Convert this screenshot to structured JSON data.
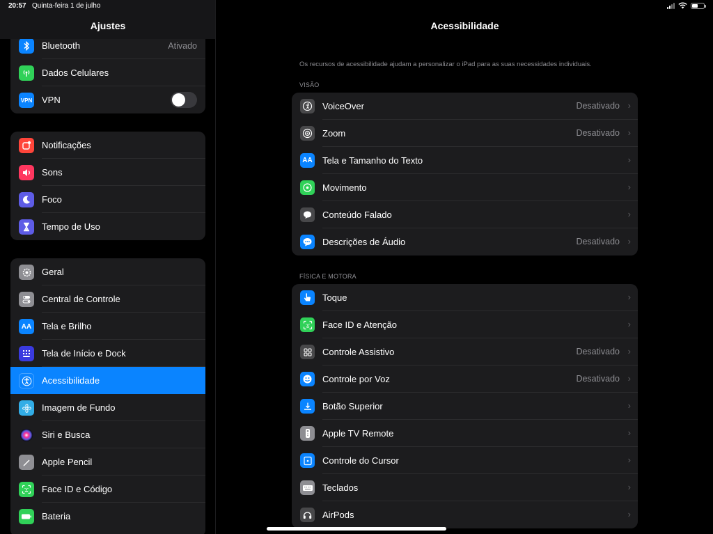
{
  "status": {
    "time": "20:57",
    "date": "Quinta-feira 1 de julho"
  },
  "sidebar": {
    "title": "Ajustes",
    "group1": [
      {
        "label": "Bluetooth",
        "value": "Ativado",
        "icon": "bluetooth-icon",
        "color": "#0a84ff"
      },
      {
        "label": "Dados Celulares",
        "icon": "antenna-icon",
        "color": "#30d158"
      },
      {
        "label": "VPN",
        "icon": "vpn-icon",
        "color": "#0a84ff"
      }
    ],
    "group2": [
      {
        "label": "Notificações",
        "icon": "notification-icon",
        "color": "#ff453a"
      },
      {
        "label": "Sons",
        "icon": "speaker-icon",
        "color": "#ff375f"
      },
      {
        "label": "Foco",
        "icon": "moon-icon",
        "color": "#5e5ce6"
      },
      {
        "label": "Tempo de Uso",
        "icon": "hourglass-icon",
        "color": "#5e5ce6"
      }
    ],
    "group3": [
      {
        "label": "Geral",
        "icon": "gear-icon",
        "color": "#8e8e93"
      },
      {
        "label": "Central de Controle",
        "icon": "switches-icon",
        "color": "#8e8e93"
      },
      {
        "label": "Tela e Brilho",
        "icon": "text-size-icon",
        "color": "#0a84ff"
      },
      {
        "label": "Tela de Início e Dock",
        "icon": "grid-icon",
        "color": "#3a3adf"
      },
      {
        "label": "Acessibilidade",
        "icon": "accessibility-icon",
        "color": "#0a84ff"
      },
      {
        "label": "Imagem de Fundo",
        "icon": "flower-icon",
        "color": "#32ade6"
      },
      {
        "label": "Siri e Busca",
        "icon": "siri-icon",
        "color": "#1c1c1e"
      },
      {
        "label": "Apple Pencil",
        "icon": "pencil-icon",
        "color": "#8e8e93"
      },
      {
        "label": "Face ID e Código",
        "icon": "face-id-icon",
        "color": "#30d158"
      },
      {
        "label": "Bateria",
        "icon": "battery-icon",
        "color": "#30d158"
      }
    ]
  },
  "main": {
    "title": "Acessibilidade",
    "intro": "Os recursos de acessibilidade ajudam a personalizar o iPad para as suas necessidades individuais.",
    "vision": {
      "title": "VISÃO",
      "items": [
        {
          "label": "VoiceOver",
          "value": "Desativado",
          "icon": "voiceover-icon",
          "color": "#48484a"
        },
        {
          "label": "Zoom",
          "value": "Desativado",
          "icon": "zoom-icon",
          "color": "#48484a"
        },
        {
          "label": "Tela e Tamanho do Texto",
          "value": "",
          "icon": "text-size-icon",
          "color": "#0a84ff"
        },
        {
          "label": "Movimento",
          "value": "",
          "icon": "motion-icon",
          "color": "#30d158"
        },
        {
          "label": "Conteúdo Falado",
          "value": "",
          "icon": "speech-bubble-icon",
          "color": "#48484a"
        },
        {
          "label": "Descrições de Áudio",
          "value": "Desativado",
          "icon": "audio-description-icon",
          "color": "#0a84ff"
        }
      ]
    },
    "motor": {
      "title": "FÍSICA E MOTORA",
      "items": [
        {
          "label": "Toque",
          "value": "",
          "icon": "hand-touch-icon",
          "color": "#0a84ff"
        },
        {
          "label": "Face ID e Atenção",
          "value": "",
          "icon": "face-id-icon",
          "color": "#30d158"
        },
        {
          "label": "Controle Assistivo",
          "value": "Desativado",
          "icon": "grid-icon",
          "color": "#48484a"
        },
        {
          "label": "Controle por Voz",
          "value": "Desativado",
          "icon": "voice-control-icon",
          "color": "#0a84ff"
        },
        {
          "label": "Botão Superior",
          "value": "",
          "icon": "top-button-icon",
          "color": "#0a84ff"
        },
        {
          "label": "Apple TV Remote",
          "value": "",
          "icon": "remote-icon",
          "color": "#8e8e93"
        },
        {
          "label": "Controle do Cursor",
          "value": "",
          "icon": "cursor-icon",
          "color": "#0a84ff"
        },
        {
          "label": "Teclados",
          "value": "",
          "icon": "keyboard-icon",
          "color": "#8e8e93"
        },
        {
          "label": "AirPods",
          "value": "",
          "icon": "airpods-icon",
          "color": "#48484a"
        }
      ]
    }
  }
}
